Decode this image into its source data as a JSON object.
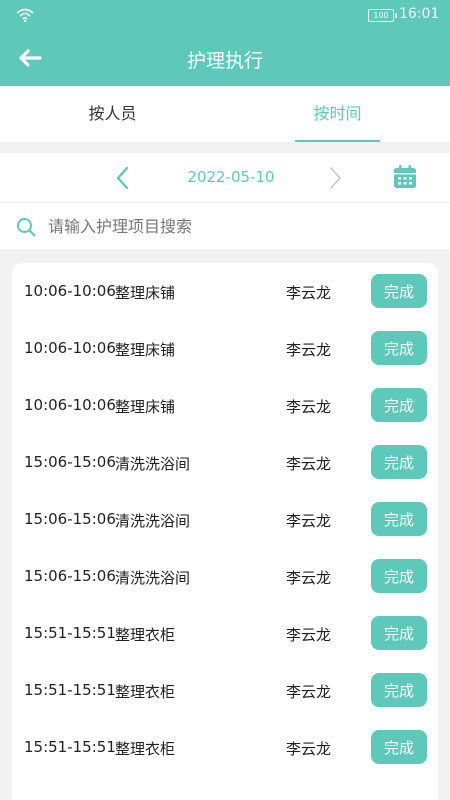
{
  "status_bar": {
    "time": "16:01",
    "battery_label": "100"
  },
  "nav": {
    "title": "护理执行"
  },
  "tabs": [
    {
      "label": "按人员",
      "active": false
    },
    {
      "label": "按时间",
      "active": true
    }
  ],
  "date_bar": {
    "date": "2022-05-10"
  },
  "search": {
    "placeholder": "请输入护理项目搜索",
    "value": ""
  },
  "rows": [
    {
      "time": "10:06-10:06",
      "task": "整理床铺",
      "person": "李云龙",
      "action": "完成"
    },
    {
      "time": "10:06-10:06",
      "task": "整理床铺",
      "person": "李云龙",
      "action": "完成"
    },
    {
      "time": "10:06-10:06",
      "task": "整理床铺",
      "person": "李云龙",
      "action": "完成"
    },
    {
      "time": "15:06-15:06",
      "task": "清洗洗浴间",
      "person": "李云龙",
      "action": "完成"
    },
    {
      "time": "15:06-15:06",
      "task": "清洗洗浴间",
      "person": "李云龙",
      "action": "完成"
    },
    {
      "time": "15:06-15:06",
      "task": "清洗洗浴间",
      "person": "李云龙",
      "action": "完成"
    },
    {
      "time": "15:51-15:51",
      "task": "整理衣柜",
      "person": "李云龙",
      "action": "完成"
    },
    {
      "time": "15:51-15:51",
      "task": "整理衣柜",
      "person": "李云龙",
      "action": "完成"
    },
    {
      "time": "15:51-15:51",
      "task": "整理衣柜",
      "person": "李云龙",
      "action": "完成"
    }
  ],
  "colors": {
    "accent": "#5ec9ba",
    "background": "#f2f2f2",
    "text": "#222222"
  }
}
